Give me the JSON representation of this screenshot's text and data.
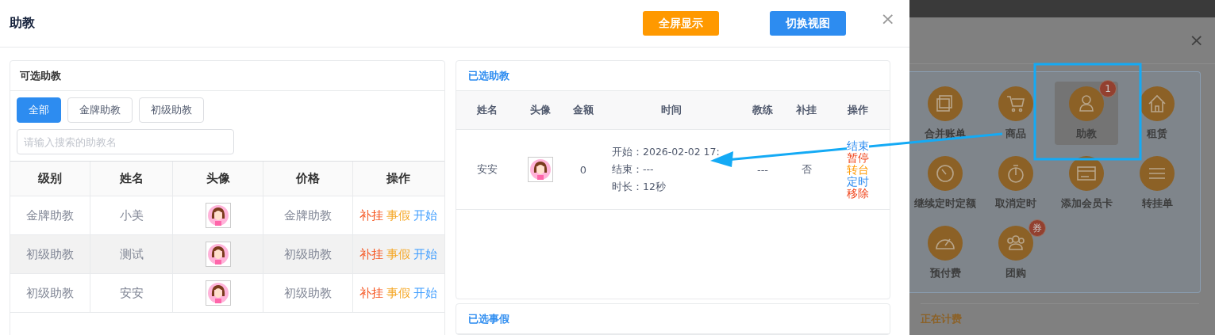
{
  "dialog": {
    "title": "助教",
    "buttons": [
      {
        "label": "全屏显示",
        "color": "#ff9900"
      },
      {
        "label": "切换视图",
        "color": "#2d8cf0"
      }
    ],
    "close": "×"
  },
  "available": {
    "title": "可选助教",
    "filters": [
      {
        "label": "全部",
        "selected": true
      },
      {
        "label": "金牌助教",
        "selected": false
      },
      {
        "label": "初级助教",
        "selected": false
      }
    ],
    "search": {
      "placeholder": "请输入搜索的助教名"
    },
    "columns": [
      "级别",
      "姓名",
      "头像",
      "价格",
      "操作"
    ],
    "rows": [
      {
        "level": "金牌助教",
        "name": "小美",
        "price": "金牌助教",
        "striped": false,
        "actions": [
          {
            "label": "补挂",
            "color": "#f5541f"
          },
          {
            "label": "事假",
            "color": "#f5a623"
          },
          {
            "label": "开始",
            "color": "#409eff"
          }
        ]
      },
      {
        "level": "初级助教",
        "name": "测试",
        "price": "初级助教",
        "striped": true,
        "actions": [
          {
            "label": "补挂",
            "color": "#f5541f"
          },
          {
            "label": "事假",
            "color": "#f5a623"
          },
          {
            "label": "开始",
            "color": "#409eff"
          }
        ]
      },
      {
        "level": "初级助教",
        "name": "安安",
        "price": "初级助教",
        "striped": false,
        "actions": [
          {
            "label": "补挂",
            "color": "#f5541f"
          },
          {
            "label": "事假",
            "color": "#f5a623"
          },
          {
            "label": "开始",
            "color": "#409eff"
          }
        ]
      }
    ]
  },
  "selected": {
    "title": "已选助教",
    "columns": [
      "姓名",
      "头像",
      "金额",
      "时间",
      "教练",
      "补挂",
      "操作"
    ],
    "rows": [
      {
        "name": "安安",
        "amount": "0",
        "time": [
          "开始：2026-02-02 17:",
          "结束：---",
          "时长：12秒"
        ],
        "coach": "---",
        "makeup": "否",
        "actions": [
          {
            "label": "结束",
            "color": "#2d8cf0"
          },
          {
            "label": "暂停",
            "color": "#f0441a"
          },
          {
            "label": "转台",
            "color": "#ff9900"
          },
          {
            "label": "定时",
            "color": "#2d8cf0"
          },
          {
            "label": "移除",
            "color": "#f0441a"
          }
        ]
      }
    ]
  },
  "leave": {
    "title": "已选事假"
  },
  "background": {
    "close": "×",
    "items": [
      {
        "label": "合并账单",
        "selected": false
      },
      {
        "label": "商品",
        "selected": false
      },
      {
        "label": "助教",
        "selected": true,
        "badge": "1"
      },
      {
        "label": "租赁",
        "selected": false
      },
      {
        "label": "继续定时定额",
        "selected": false
      },
      {
        "label": "取消定时",
        "selected": false
      },
      {
        "label": "添加会员卡",
        "selected": false
      },
      {
        "label": "转挂单",
        "selected": false
      },
      {
        "label": "预付费",
        "selected": false
      },
      {
        "label": "团购",
        "selected": false,
        "badge": "券"
      }
    ],
    "status": "正在计费"
  }
}
